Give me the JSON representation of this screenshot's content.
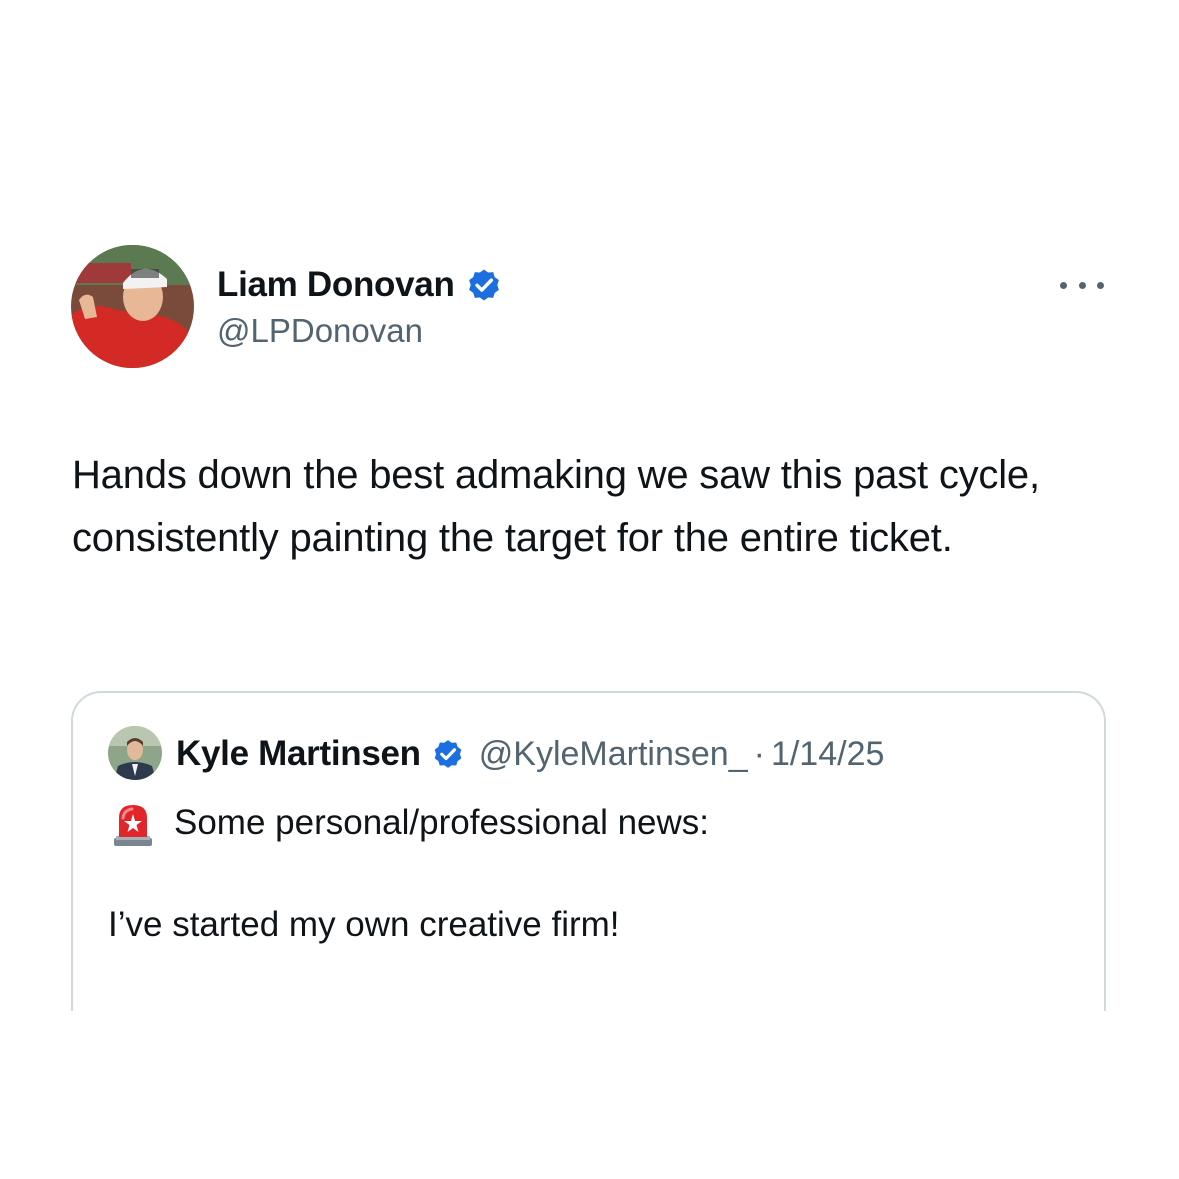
{
  "tweet": {
    "author_name": "Liam Donovan",
    "author_handle": "@LPDonovan",
    "text": "Hands down the best admaking we saw this past cycle, consistently painting the target for the entire ticket."
  },
  "quoted_tweet": {
    "author_name": "Kyle Martinsen",
    "author_handle": "@KyleMartinsen_",
    "separator": "·",
    "date": "1/14/25",
    "line1": "Some personal/professional news:",
    "line2": "I’ve started my own creative firm!"
  },
  "icons": {
    "verified": "verified-badge-icon",
    "more": "more-options-icon",
    "siren": "siren-emoji-icon"
  },
  "colors": {
    "verified_blue": "#1d6fe0",
    "secondary_text": "#536471",
    "border": "#cfd9de"
  }
}
